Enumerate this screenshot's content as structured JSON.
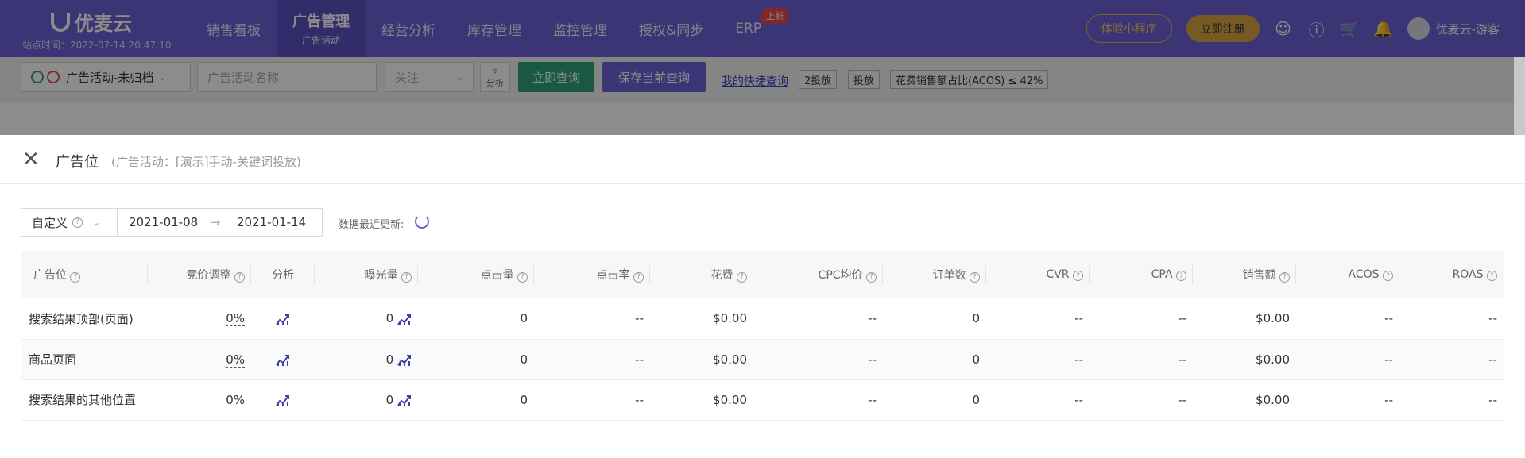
{
  "header": {
    "logo_text": "优麦云",
    "station_time": "站点时间：2022-07-14 20:47:10",
    "nav": [
      {
        "label": "销售看板"
      },
      {
        "label": "广告管理",
        "sub": "广告活动"
      },
      {
        "label": "经营分析"
      },
      {
        "label": "库存管理"
      },
      {
        "label": "监控管理"
      },
      {
        "label": "授权&同步"
      },
      {
        "label": "ERP",
        "badge": "上新"
      }
    ],
    "btn_mini": "体验小程序",
    "btn_register": "立即注册",
    "user_name": "优麦云-游客"
  },
  "filter": {
    "status_select": "广告活动-未归档",
    "name_placeholder": "广告活动名称",
    "follow_select": "关注",
    "analyze": "分析",
    "query_btn": "立即查询",
    "save_btn": "保存当前查询",
    "quick_link": "我的快捷查询",
    "tags": [
      "2投放",
      "投放",
      "花费销售额占比(ACOS) ≤ 42%"
    ]
  },
  "drawer": {
    "title": "广告位",
    "subtitle": "(广告活动：[演示]手动-关键词投放)",
    "range_type": "自定义",
    "start_date": "2021-01-08",
    "end_date": "2021-01-14",
    "update_label": "数据最近更新:"
  },
  "table": {
    "headers": [
      "广告位",
      "竞价调整",
      "分析",
      "曝光量",
      "点击量",
      "点击率",
      "花费",
      "CPC均价",
      "订单数",
      "CVR",
      "CPA",
      "销售额",
      "ACOS",
      "ROAS"
    ],
    "rows": [
      {
        "placement": "搜索结果顶部(页面)",
        "bid": "0%",
        "impr": "0",
        "clicks": "0",
        "ctr": "--",
        "spend": "$0.00",
        "cpc": "--",
        "orders": "0",
        "cvr": "--",
        "cpa": "--",
        "sales": "$0.00",
        "acos": "--",
        "roas": "--"
      },
      {
        "placement": "商品页面",
        "bid": "0%",
        "impr": "0",
        "clicks": "0",
        "ctr": "--",
        "spend": "$0.00",
        "cpc": "--",
        "orders": "0",
        "cvr": "--",
        "cpa": "--",
        "sales": "$0.00",
        "acos": "--",
        "roas": "--"
      },
      {
        "placement": "搜索结果的其他位置",
        "bid": "0%",
        "impr": "0",
        "clicks": "0",
        "ctr": "--",
        "spend": "$0.00",
        "cpc": "--",
        "orders": "0",
        "cvr": "--",
        "cpa": "--",
        "sales": "$0.00",
        "acos": "--",
        "roas": "--"
      }
    ]
  },
  "colors": {
    "brand": "#6c62d6",
    "query_green": "#2fa37a",
    "gold": "#d6a640"
  },
  "icons": [
    "logo-icon",
    "support-icon",
    "help-icon",
    "cart-icon",
    "bell-icon",
    "close-icon",
    "refresh-icon",
    "trend-chart-icon"
  ]
}
